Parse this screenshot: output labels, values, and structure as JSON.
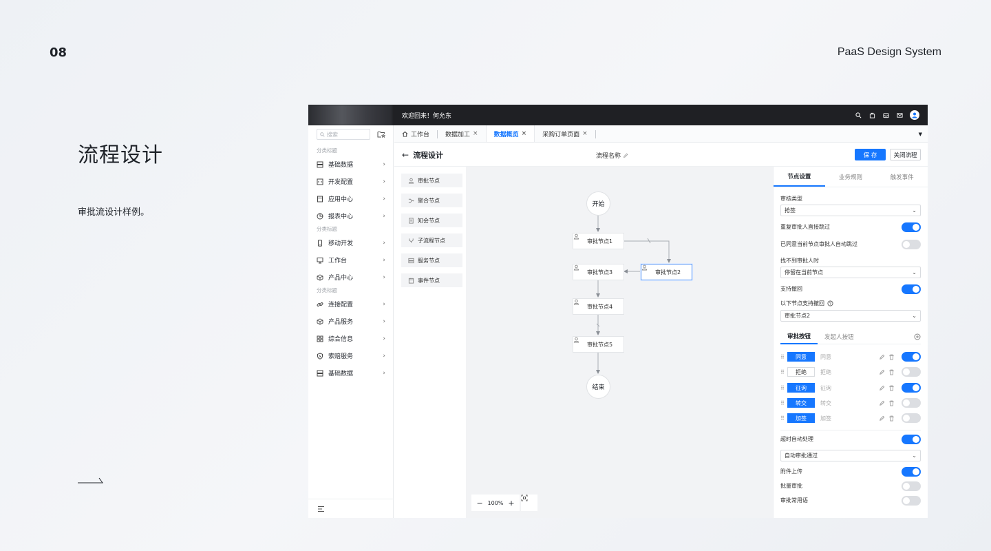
{
  "slide": {
    "number": "08",
    "brand": "PaaS Design System",
    "title": "流程设计",
    "description": "审批流设计样例。"
  },
  "topbar": {
    "welcome": "欢迎回来！何允东"
  },
  "sidebar": {
    "search_placeholder": "搜索",
    "groups": [
      {
        "label": "分类标题",
        "items": [
          {
            "label": "基础数据",
            "icon": "database-icon"
          },
          {
            "label": "开发配置",
            "icon": "code-icon"
          },
          {
            "label": "应用中心",
            "icon": "app-icon"
          },
          {
            "label": "报表中心",
            "icon": "pie-chart-icon"
          }
        ]
      },
      {
        "label": "分类标题",
        "items": [
          {
            "label": "移动开发",
            "icon": "mobile-icon"
          },
          {
            "label": "工作台",
            "icon": "monitor-icon"
          },
          {
            "label": "产品中心",
            "icon": "cube-icon"
          }
        ]
      },
      {
        "label": "分类标题",
        "items": [
          {
            "label": "连接配置",
            "icon": "link-icon"
          },
          {
            "label": "产品服务",
            "icon": "cube-icon"
          },
          {
            "label": "综合信息",
            "icon": "grid-icon"
          },
          {
            "label": "索赔服务",
            "icon": "shield-icon"
          },
          {
            "label": "基础数据",
            "icon": "database-icon"
          }
        ]
      }
    ]
  },
  "tabs": {
    "home": "工作台",
    "items": [
      {
        "label": "数据加工",
        "active": false
      },
      {
        "label": "数据概览",
        "active": true
      },
      {
        "label": "采购订单页面",
        "active": false
      }
    ]
  },
  "page": {
    "title": "流程设计",
    "flow_name": "流程名称",
    "save": "保 存",
    "close": "关闭流程"
  },
  "node_palette": [
    {
      "label": "审批节点",
      "icon": "user-icon"
    },
    {
      "label": "聚合节点",
      "icon": "merge-icon"
    },
    {
      "label": "知会节点",
      "icon": "doc-icon"
    },
    {
      "label": "子流程节点",
      "icon": "branch-icon"
    },
    {
      "label": "服务节点",
      "icon": "server-icon"
    },
    {
      "label": "事件节点",
      "icon": "event-icon"
    }
  ],
  "flow": {
    "start": "开始",
    "end": "结束",
    "nodes": [
      "审批节点1",
      "审批节点2",
      "审批节点3",
      "审批节点4",
      "审批节点5"
    ],
    "zoom": "100%"
  },
  "props": {
    "tabs": [
      "节点设置",
      "业务规则",
      "触发事件"
    ],
    "approval_type_label": "审核类型",
    "approval_type_value": "抢签",
    "repeat_skip_label": "重复审批人直接跳过",
    "repeat_skip_on": true,
    "auto_skip_label": "已同意当前节点审批人自动跳过",
    "auto_skip_on": false,
    "not_found_label": "找不到审批人时",
    "not_found_value": "停留在当前节点",
    "withdraw_label": "支持撤回",
    "withdraw_on": true,
    "withdraw_nodes_label": "以下节点支持撤回",
    "withdraw_nodes_value": "审批节点2",
    "btn_tabs": [
      "审批按钮",
      "发起人按钮"
    ],
    "buttons": [
      {
        "chip": "同意",
        "name": "同意",
        "filled": true,
        "on": true
      },
      {
        "chip": "拒绝",
        "name": "拒绝",
        "filled": false,
        "on": false
      },
      {
        "chip": "征询",
        "name": "征询",
        "filled": true,
        "on": true
      },
      {
        "chip": "转交",
        "name": "转交",
        "filled": true,
        "on": false
      },
      {
        "chip": "加签",
        "name": "加签",
        "filled": true,
        "on": false
      }
    ],
    "timeout_label": "超时自动处理",
    "timeout_on": true,
    "timeout_value": "自动审批通过",
    "attach_label": "附件上传",
    "attach_on": true,
    "batch_label": "批量审批",
    "batch_on": false,
    "phrases_label": "审批常用语",
    "phrases_on": false
  }
}
